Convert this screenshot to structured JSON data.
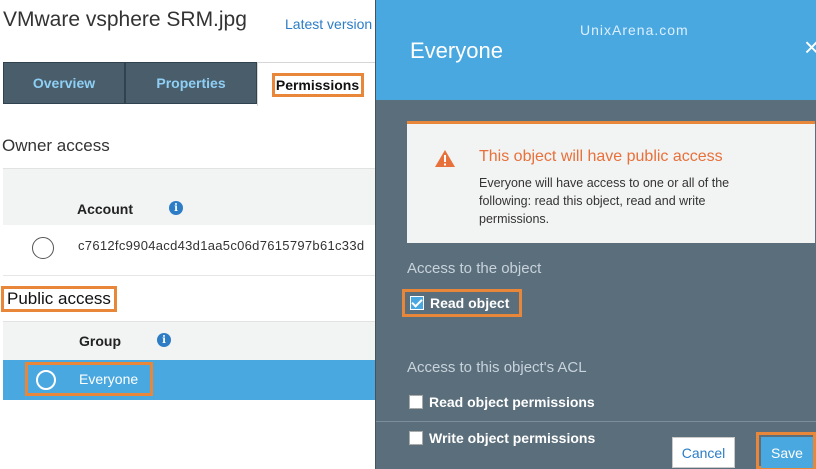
{
  "header": {
    "title": "VMware vsphere SRM.jpg",
    "version_link": "Latest version"
  },
  "tabs": [
    {
      "label": "Overview"
    },
    {
      "label": "Properties"
    },
    {
      "label": "Permissions"
    }
  ],
  "owner_access": {
    "heading": "Owner access",
    "column": "Account",
    "info_glyph": "i",
    "account_id": "c7612fc9904acd43d1aa5c06d7615797b61c33d"
  },
  "public_access": {
    "heading": "Public access",
    "column": "Group",
    "info_glyph": "i",
    "group": "Everyone"
  },
  "panel": {
    "title": "Everyone",
    "watermark": "UnixArena.com",
    "close_glyph": "×",
    "warning_title": "This object will have public access",
    "warning_body": "Everyone will have access to one or all of the following: read this object, read and write permissions.",
    "access_object_heading": "Access to the object",
    "read_object": "Read object",
    "access_acl_heading": "Access to this object's ACL",
    "read_perms": "Read object permissions",
    "write_perms": "Write object permissions",
    "cancel": "Cancel",
    "save": "Save"
  },
  "colors": {
    "accent": "#4aa8e0",
    "highlight": "#e8873a",
    "panel_bg": "#5b6e7b",
    "warning": "#e8703a"
  },
  "icons": [
    "info-icon",
    "warning-icon",
    "close-icon",
    "checkbox-icon",
    "radio-icon"
  ]
}
